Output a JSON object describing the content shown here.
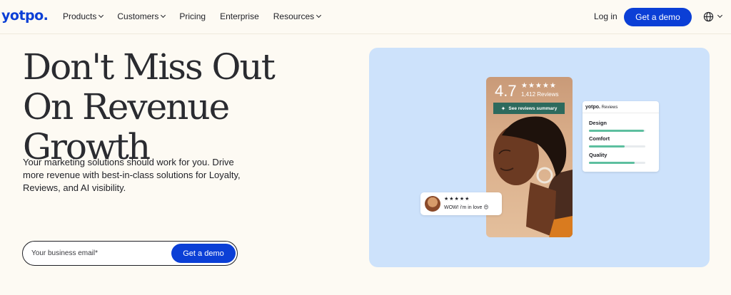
{
  "nav": {
    "logo": "yotpo.",
    "items": [
      {
        "label": "Products",
        "dropdown": true
      },
      {
        "label": "Customers",
        "dropdown": true
      },
      {
        "label": "Pricing",
        "dropdown": false
      },
      {
        "label": "Enterprise",
        "dropdown": false
      },
      {
        "label": "Resources",
        "dropdown": true
      }
    ],
    "login": "Log in",
    "cta": "Get a demo",
    "language_icon": "globe-icon"
  },
  "hero": {
    "headline_lines": [
      "Don't Miss Out",
      "On Revenue",
      "Growth"
    ],
    "subtitle": "Your marketing solutions should work for you. Drive more revenue with best-in-class solutions for Loyalty, Reviews, and AI visibility.",
    "email_placeholder": "Your business email*",
    "email_value": "",
    "form_cta": "Get a demo"
  },
  "visual": {
    "rating": "4.7",
    "stars": "★★★★★",
    "review_count": "1,412 Reviews",
    "summary_button": "See reviews summary",
    "card": {
      "brand": "yotpo.",
      "title": "Reviews",
      "metrics": [
        {
          "label": "Design",
          "level": 0.97
        },
        {
          "label": "Comfort",
          "level": 0.63
        },
        {
          "label": "Quality",
          "level": 0.81
        }
      ]
    },
    "comment": {
      "stars": "★★★★★",
      "text": "WOW! i'm in love 😍"
    }
  },
  "colors": {
    "brand_blue": "#0b3fd6",
    "page_bg": "#fdfaf3",
    "panel_bg": "#cde2fb",
    "metric_fill": "#5dbf9f",
    "summary_bg": "#2d6a5d"
  }
}
